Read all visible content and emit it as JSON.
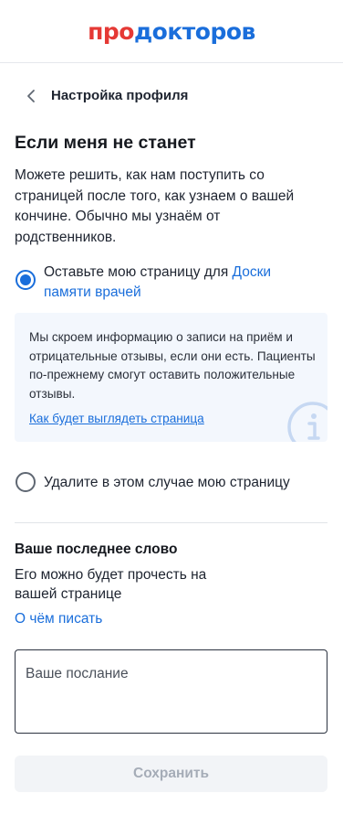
{
  "logo": {
    "part1": "про",
    "part2": "докторов"
  },
  "topbar": {
    "title": "Настройка профиля"
  },
  "page": {
    "heading": "Если меня не станет",
    "intro": "Можете решить, как нам поступить со страницей после того, как узнаем о вашей кончине. Обычно мы узнаём от родственников."
  },
  "options": {
    "option1": {
      "label_prefix": "Оставьте мою страницу для ",
      "label_link": "Доски памяти врачей",
      "checked": true
    },
    "option2": {
      "label": "Удалите в этом случае мою страницу",
      "checked": false
    }
  },
  "info": {
    "text": "Мы скроем информацию о записи на приём и отрицательные отзывы, если они есть. Пациенты по-прежнему смогут оставить положительные отзывы.",
    "link": "Как будет выглядеть страница"
  },
  "last_word": {
    "heading": "Ваше последнее слово",
    "subtitle": "Его можно будет прочесть на вашей странице",
    "link": "О чём писать",
    "placeholder": "Ваше послание"
  },
  "save_button": {
    "label": "Сохранить"
  },
  "colors": {
    "brand_red": "#e53935",
    "brand_blue": "#1a6edb",
    "info_bg": "#f3f7fd"
  },
  "icons": {
    "back": "chevron-left-icon",
    "info": "info-icon"
  }
}
